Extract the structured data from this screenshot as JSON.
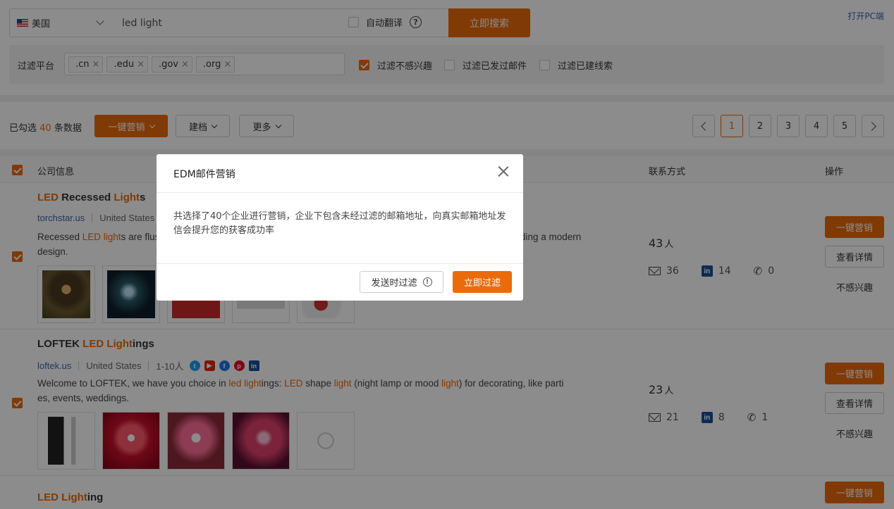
{
  "search": {
    "country": "美国",
    "query": "led light",
    "auto_translate_label": "自动翻译",
    "search_button": "立即搜索",
    "open_pc_link": "打开PC端"
  },
  "filter": {
    "label": "过滤平台",
    "tags": [
      ".cn",
      ".edu",
      ".gov",
      ".org"
    ],
    "options": [
      {
        "label": "过滤不感兴趣",
        "checked": true
      },
      {
        "label": "过滤已发过邮件",
        "checked": false
      },
      {
        "label": "过滤已建线索",
        "checked": false
      }
    ]
  },
  "toolbar": {
    "selected_prefix": "已勾选",
    "selected_count": "40",
    "selected_suffix": "条数据",
    "marketing_button": "一键营销",
    "archive_button": "建档",
    "more_button": "更多",
    "pages": [
      "1",
      "2",
      "3",
      "4",
      "5"
    ],
    "active_page": "1"
  },
  "table": {
    "col_company": "公司信息",
    "col_contact": "联系方式",
    "col_action": "操作"
  },
  "rows": [
    {
      "name_parts": [
        {
          "t": "LED",
          "hl": true
        },
        {
          "t": " Recessed ",
          "hl": false
        },
        {
          "t": "Light",
          "hl": true
        },
        {
          "t": "s",
          "hl": false
        }
      ],
      "domain": "torchstar.us",
      "country": "United States",
      "desc_visible": "Recessed ",
      "desc_hl": "LED light",
      "desc_rest": "s are flus",
      "desc_tail": "ding a modern",
      "desc_line2": "design.",
      "people": "43",
      "people_unit": "人",
      "emails": "36",
      "linkedin": "14",
      "phones": "0"
    },
    {
      "name_parts": [
        {
          "t": "LOFTEK ",
          "hl": false
        },
        {
          "t": "LED",
          "hl": true
        },
        {
          "t": " ",
          "hl": false
        },
        {
          "t": "Light",
          "hl": true
        },
        {
          "t": "ings",
          "hl": false
        }
      ],
      "domain": "loftek.us",
      "country": "United States",
      "size": "1-10人",
      "desc_segments": [
        {
          "t": "Welcome to LOFTEK, we have you choice in ",
          "hl": false
        },
        {
          "t": "led light",
          "hl": true
        },
        {
          "t": "ings: ",
          "hl": false
        },
        {
          "t": "LED",
          "hl": true
        },
        {
          "t": " shape ",
          "hl": false
        },
        {
          "t": "light",
          "hl": true
        },
        {
          "t": " (night lamp or mood ",
          "hl": false
        },
        {
          "t": "light",
          "hl": true
        },
        {
          "t": ") for decorating, like parti",
          "hl": false
        }
      ],
      "desc_line2": "es, events, weddings.",
      "people": "23",
      "people_unit": "人",
      "emails": "21",
      "linkedin": "8",
      "phones": "1"
    },
    {
      "name_parts": [
        {
          "t": "LED",
          "hl": true
        },
        {
          "t": " ",
          "hl": false
        },
        {
          "t": "Light",
          "hl": true
        },
        {
          "t": "ing",
          "hl": false
        }
      ]
    }
  ],
  "actions": {
    "marketing": "一键营销",
    "details": "查看详情",
    "not_interested": "不感兴趣"
  },
  "modal": {
    "title": "EDM邮件营销",
    "body": "共选择了40个企业进行营销，企业下包含未经过滤的邮箱地址，向真实邮箱地址发信会提升您的获客成功率",
    "filter_on_send": "发送时过滤",
    "filter_now": "立即过滤"
  },
  "colors": {
    "accent": "#ea6b0c",
    "link": "#3a66b0"
  }
}
